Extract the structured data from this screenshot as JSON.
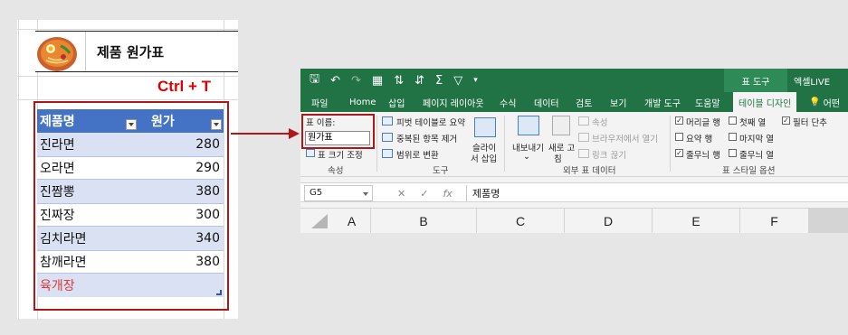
{
  "sheet": {
    "title": "제품 원가표",
    "shortcut": "Ctrl + T",
    "headers": [
      "제품명",
      "원가"
    ],
    "rows": [
      {
        "name": "진라면",
        "price": "280"
      },
      {
        "name": "오라면",
        "price": "290"
      },
      {
        "name": "진짬뽕",
        "price": "380"
      },
      {
        "name": "진짜장",
        "price": "300"
      },
      {
        "name": "김치라면",
        "price": "340"
      },
      {
        "name": "참깨라면",
        "price": "380"
      }
    ],
    "extra_row": "육개장"
  },
  "excel": {
    "qat_icons": [
      "save-icon",
      "undo-icon",
      "redo-icon",
      "table-icon",
      "sort-asc-icon",
      "sort-desc-icon",
      "sum-icon",
      "filter-icon",
      "more-icon"
    ],
    "tool_context": "표 도구",
    "username": "엑셀LIVE",
    "tabs": [
      "파일",
      "Home",
      "삽입",
      "페이지 레이아웃",
      "수식",
      "데이터",
      "검토",
      "보기",
      "개발 도구",
      "도움말",
      "테이블 디자인",
      "어떤"
    ],
    "ribbon": {
      "name_label": "표 이름:",
      "name_value": "원가표",
      "resize": "표 크기 조정",
      "props_group": "속성",
      "tools": [
        "피벗 테이블로 요약",
        "중복된 항목 제거",
        "범위로 변환"
      ],
      "slicer": [
        "슬라이",
        "서 삽입"
      ],
      "tools_group": "도구",
      "export": "내보내기",
      "refresh": [
        "새로 고",
        "침"
      ],
      "ext_items": [
        "속성",
        "브라우저에서 열기",
        "링크 끊기"
      ],
      "ext_group": "외부 표 데이터",
      "style_options": [
        {
          "label": "머리글 행",
          "checked": true
        },
        {
          "label": "첫째 열",
          "checked": false
        },
        {
          "label": "필터 단추",
          "checked": true
        },
        {
          "label": "요약 행",
          "checked": false
        },
        {
          "label": "마지막 열",
          "checked": false
        },
        {
          "label": "줄무늬 행",
          "checked": true
        },
        {
          "label": "줄무늬 열",
          "checked": false
        }
      ],
      "style_group": "표 스타일 옵션"
    },
    "namebox": "G5",
    "formula": "제품명",
    "columns": [
      "A",
      "B",
      "C",
      "D",
      "E",
      "F"
    ]
  }
}
